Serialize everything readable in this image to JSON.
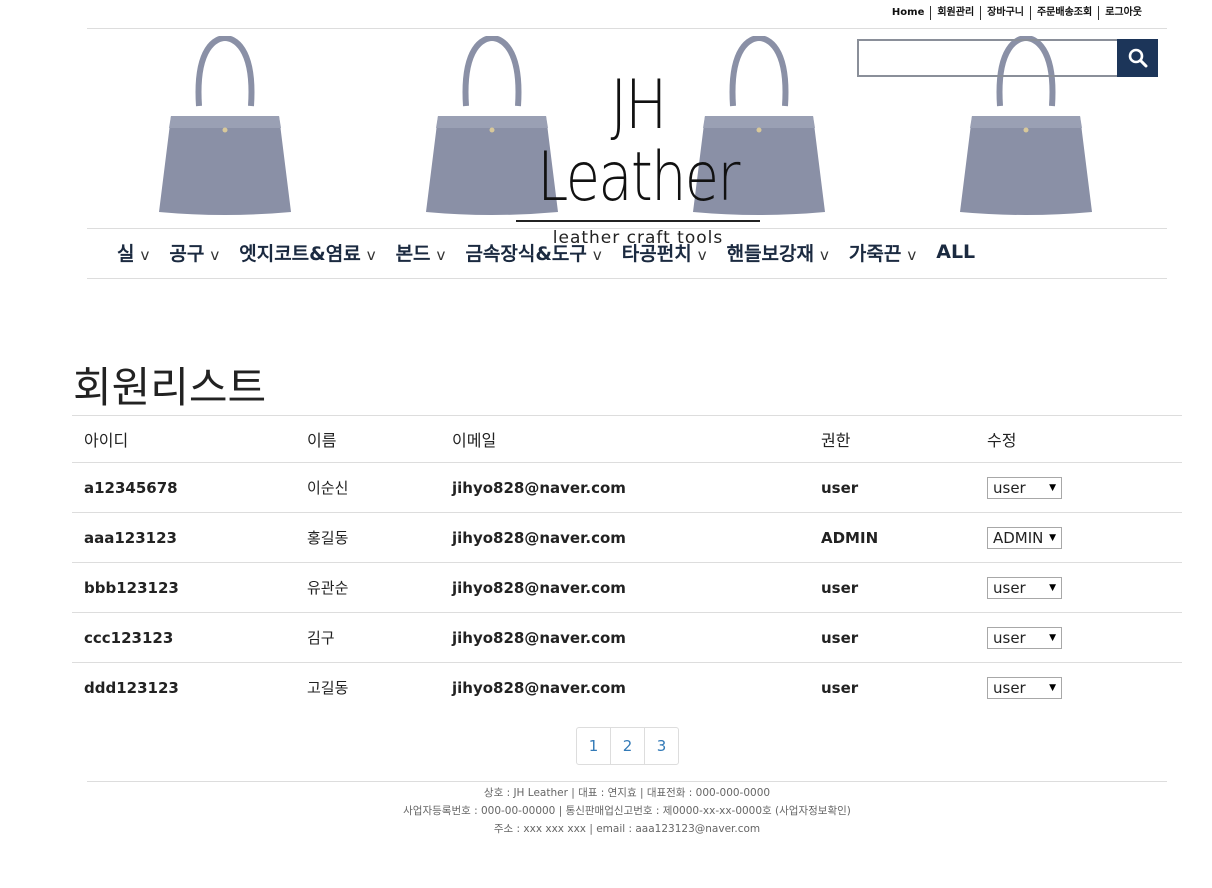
{
  "top_links": [
    "Home",
    "회원관리",
    "장바구니",
    "주문배송조회",
    "로그아웃"
  ],
  "logo": {
    "title": "JH Leather",
    "subtitle": "leather craft tools"
  },
  "search": {
    "placeholder": "",
    "icon": "search-icon"
  },
  "nav": {
    "items": [
      "실",
      "공구",
      "엣지코트&염료",
      "본드",
      "금속장식&도구",
      "타공펀치",
      "핸들보강재",
      "가죽끈",
      "ALL"
    ],
    "chevron": "v"
  },
  "page_title": "회원리스트",
  "table": {
    "headers": [
      "아이디",
      "이름",
      "이메일",
      "권한",
      "수정"
    ],
    "rows": [
      {
        "id": "a12345678",
        "name": "이순신",
        "email": "jihyo828@naver.com",
        "role": "user",
        "edit": "user"
      },
      {
        "id": "aaa123123",
        "name": "홍길동",
        "email": "jihyo828@naver.com",
        "role": "ADMIN",
        "edit": "ADMIN"
      },
      {
        "id": "bbb123123",
        "name": "유관순",
        "email": "jihyo828@naver.com",
        "role": "user",
        "edit": "user"
      },
      {
        "id": "ccc123123",
        "name": "김구",
        "email": "jihyo828@naver.com",
        "role": "user",
        "edit": "user"
      },
      {
        "id": "ddd123123",
        "name": "고길동",
        "email": "jihyo828@naver.com",
        "role": "user",
        "edit": "user"
      }
    ]
  },
  "pagination": [
    "1",
    "2",
    "3"
  ],
  "footer": [
    "상호 : JH Leather | 대표 : 연지효 | 대표전화 : 000-000-0000",
    "사업자등록번호 : 000-00-00000 | 통신판매업신고번호 : 제0000-xx-xx-0000호 (사업자정보확인)",
    "주소 : xxx xxx xxx | email : aaa123123@naver.com"
  ],
  "colors": {
    "accent": "#1c3559",
    "nav_text": "#1b2a40",
    "bag": "#8a90a6",
    "link": "#337ab7"
  }
}
